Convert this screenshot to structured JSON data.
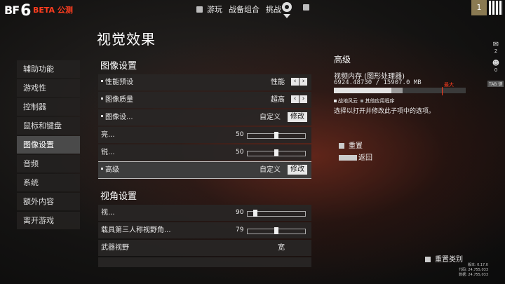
{
  "header": {
    "logo": "BF",
    "logo_num": "6",
    "beta": "BETA 公测",
    "nav": [
      {
        "label": "游玩",
        "dot": false
      },
      {
        "label": "战备组合",
        "dot": false
      },
      {
        "label": "挑战",
        "dot": true
      }
    ],
    "settings_icon": "gear-icon",
    "player_level": "1"
  },
  "page_title": "视觉效果",
  "sidebar": {
    "items": [
      {
        "label": "辅助功能",
        "active": false
      },
      {
        "label": "游戏性",
        "active": false
      },
      {
        "label": "控制器",
        "active": false
      },
      {
        "label": "鼠标和键盘",
        "active": false
      },
      {
        "label": "图像设置",
        "active": true
      },
      {
        "label": "音频",
        "active": false
      },
      {
        "label": "系统",
        "active": false
      },
      {
        "label": "额外内容",
        "active": false
      },
      {
        "label": "离开游戏",
        "active": false
      }
    ]
  },
  "graphics": {
    "section_title": "图像设置",
    "preset": {
      "label": "性能预设",
      "value": "性能"
    },
    "quality": {
      "label": "图像质量",
      "value": "超高"
    },
    "graphics_setting": {
      "label": "图像设...",
      "value": "自定义",
      "button": "修改"
    },
    "brightness": {
      "label": "亮...",
      "value": "50",
      "level": 0.5
    },
    "sharpness": {
      "label": "锐...",
      "value": "50",
      "level": 0.5
    },
    "advanced": {
      "label": "高级",
      "value": "自定义",
      "button": "修改"
    }
  },
  "camera": {
    "section_title": "视角设置",
    "fov": {
      "label": "视...",
      "value": "90",
      "level": 0.1
    },
    "vehicle_fov": {
      "label": "载具第三人称视野角...",
      "value": "79",
      "level": 0.5
    },
    "weapon_fov": {
      "label": "武器视野",
      "value": "宽"
    }
  },
  "detail": {
    "title": "高级",
    "vram_label": "视频内存 (图形处理器)",
    "vram_value": "6924.48730 / 15907.0 MB",
    "vram_used_fraction": 0.435,
    "vram_other_fraction": 0.085,
    "max_label": "最大",
    "legend_game": "战地风云",
    "legend_other": "其他应用程序",
    "hint": "选择以打开并修改此子项中的选项。",
    "reset": "重置",
    "back": "返回"
  },
  "right_icons": {
    "mail_count": "2",
    "friends_count": "0",
    "tab_key": "TAB 键"
  },
  "footer": {
    "reset_category": "重置类别",
    "version_lines": [
      "版本: 0.17.0",
      "代码: 24,755,033",
      "数据: 24,755,033"
    ]
  },
  "colors": {
    "accent": "#ff3d1f",
    "active_sidebar": "#4a4a4a"
  }
}
